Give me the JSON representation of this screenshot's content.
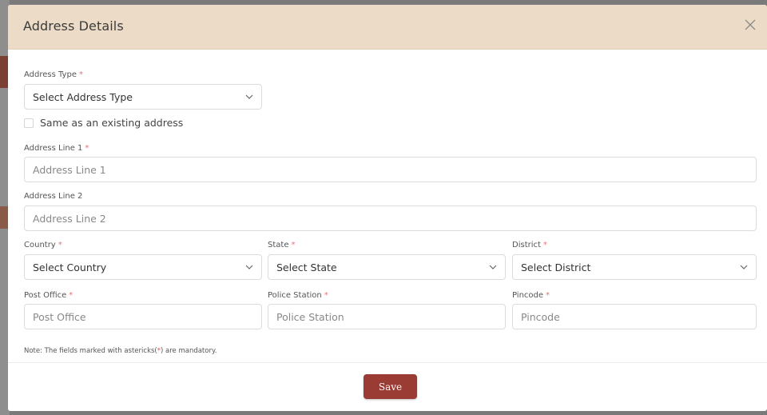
{
  "modal": {
    "title": "Address Details",
    "close_icon": "close-icon"
  },
  "form": {
    "address_type": {
      "label": "Address Type",
      "required_mark": "*",
      "value": "Select Address Type"
    },
    "same_as_existing": {
      "label": "Same as an existing address",
      "checked": false
    },
    "address_line_1": {
      "label": "Address Line 1",
      "required_mark": "*",
      "placeholder": "Address Line 1",
      "value": ""
    },
    "address_line_2": {
      "label": "Address Line 2",
      "placeholder": "Address Line 2",
      "value": ""
    },
    "country": {
      "label": "Country",
      "required_mark": "*",
      "value": "Select Country"
    },
    "state": {
      "label": "State",
      "required_mark": "*",
      "value": "Select State"
    },
    "district": {
      "label": "District",
      "required_mark": "*",
      "value": "Select District"
    },
    "post_office": {
      "label": "Post Office",
      "required_mark": "*",
      "placeholder": "Post Office",
      "value": ""
    },
    "police_station": {
      "label": "Police Station",
      "required_mark": "*",
      "placeholder": "Police Station",
      "value": ""
    },
    "pincode": {
      "label": "Pincode",
      "required_mark": "*",
      "placeholder": "Pincode",
      "value": ""
    }
  },
  "note": {
    "prefix": "Note: The fields marked with astericks(",
    "mark": "*",
    "suffix": ") are mandatory."
  },
  "footer": {
    "save_label": "Save"
  },
  "colors": {
    "header_bg": "#ecdcc7",
    "save_button": "#9a3b34",
    "required": "#e57373"
  }
}
